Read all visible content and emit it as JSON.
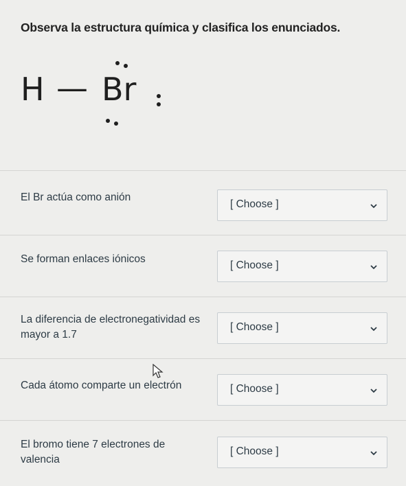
{
  "title": "Observa la estructura química y clasifica los enunciados.",
  "formula": {
    "h": "H",
    "dash": "—",
    "br": "Br"
  },
  "questions": [
    {
      "text": "El Br actúa como anión",
      "select": "[ Choose ]"
    },
    {
      "text": "Se forman enlaces iónicos",
      "select": "[ Choose ]"
    },
    {
      "text": "La diferencia de electronegatividad es mayor a 1.7",
      "select": "[ Choose ]"
    },
    {
      "text": "Cada átomo comparte un electrón",
      "select": "[ Choose ]"
    },
    {
      "text": "El bromo tiene 7 electrones de valencia",
      "select": "[ Choose ]"
    }
  ]
}
